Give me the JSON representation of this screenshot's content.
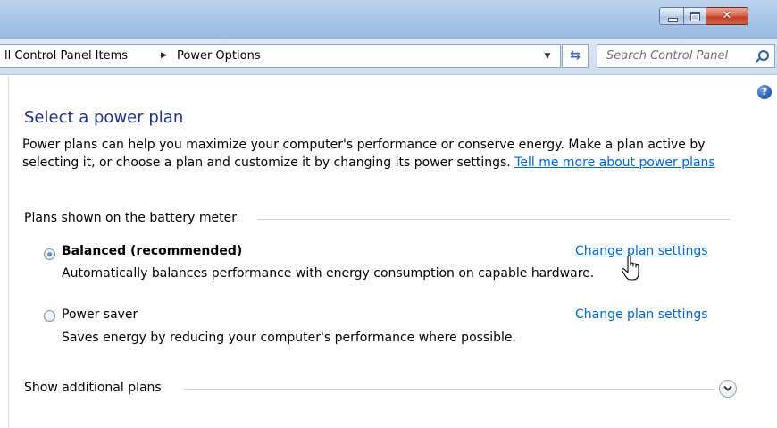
{
  "window": {
    "close_glyph": "✕"
  },
  "address": {
    "crumb_1": "ll Control Panel Items",
    "crumb_separator": "▶",
    "crumb_2": "Power Options",
    "dropdown_glyph": "▼",
    "refresh_glyph": "⇆",
    "search_placeholder": "Search Control Panel"
  },
  "help": {
    "glyph": "?"
  },
  "page": {
    "heading": "Select a power plan",
    "description": "Power plans can help you maximize your computer's performance or conserve energy. Make a plan active by selecting it, or choose a plan and customize it by changing its power settings.",
    "description_link": "Tell me more about power plans"
  },
  "plans_group": {
    "label": "Plans shown on the battery meter",
    "plans": [
      {
        "name": "Balanced (recommended)",
        "description": "Automatically balances performance with energy consumption on capable hardware.",
        "link": "Change plan settings",
        "selected": true
      },
      {
        "name": "Power saver",
        "description": "Saves energy by reducing your computer's performance where possible.",
        "link": "Change plan settings",
        "selected": false
      }
    ]
  },
  "additional_plans": {
    "label": "Show additional plans",
    "expand_icon": "chevron-down-icon"
  },
  "colors": {
    "heading": "#1e3287",
    "link": "#0066cc",
    "close_button": "#c2422a"
  }
}
